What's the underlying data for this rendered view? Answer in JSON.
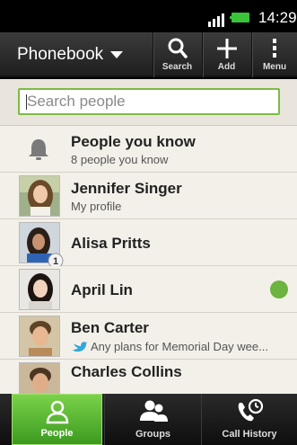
{
  "status": {
    "time": "14:29"
  },
  "action_bar": {
    "title": "Phonebook",
    "search_label": "Search",
    "add_label": "Add",
    "menu_label": "Menu"
  },
  "search": {
    "placeholder": "Search people"
  },
  "contacts": [
    {
      "name": "People you know",
      "sub": "8 people you know"
    },
    {
      "name": "Jennifer Singer",
      "sub": "My profile"
    },
    {
      "name": "Alisa Pritts",
      "badge": "1"
    },
    {
      "name": "April Lin",
      "presence": "online"
    },
    {
      "name": "Ben Carter",
      "sub": "Any plans for Memorial Day wee..."
    },
    {
      "name": "Charles Collins"
    }
  ],
  "tabs": [
    {
      "label": "People",
      "active": true
    },
    {
      "label": "Groups"
    },
    {
      "label": "Call History"
    }
  ],
  "colors": {
    "accent": "#6cc93c",
    "presence_online": "#6cb33f"
  }
}
